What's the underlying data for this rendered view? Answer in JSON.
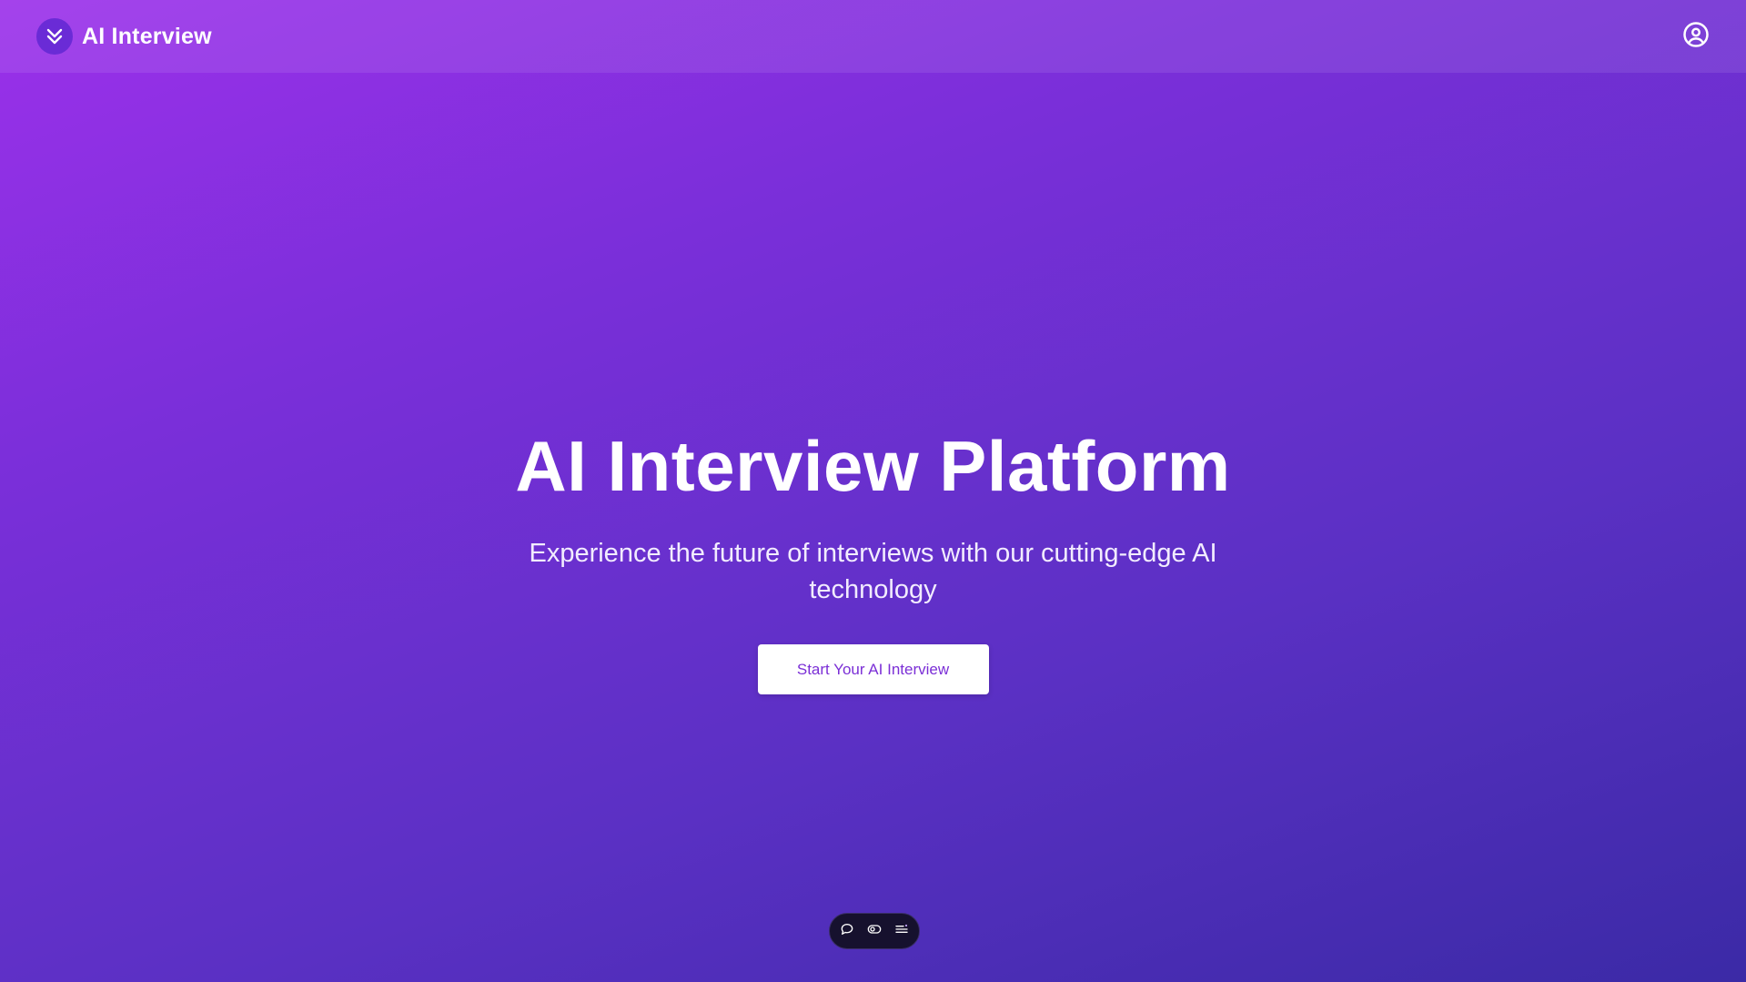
{
  "header": {
    "brand_name": "AI Interview",
    "logo_icon": "double-chevron-down-icon",
    "profile_icon": "user-circle-icon"
  },
  "hero": {
    "title": "AI Interview Platform",
    "subtitle": "Experience the future of interviews with our cutting-edge AI technology",
    "cta_label": "Start Your AI Interview"
  },
  "toolbar": {
    "icons": [
      "chat-bubble-icon",
      "toggle-icon",
      "list-menu-icon"
    ]
  },
  "colors": {
    "gradient_start": "#9b30ea",
    "gradient_end": "#3b2aa6",
    "cta_text": "#7b2fd6",
    "logo_bg": "#6a2bd6",
    "toolbar_bg": "#16112e"
  }
}
